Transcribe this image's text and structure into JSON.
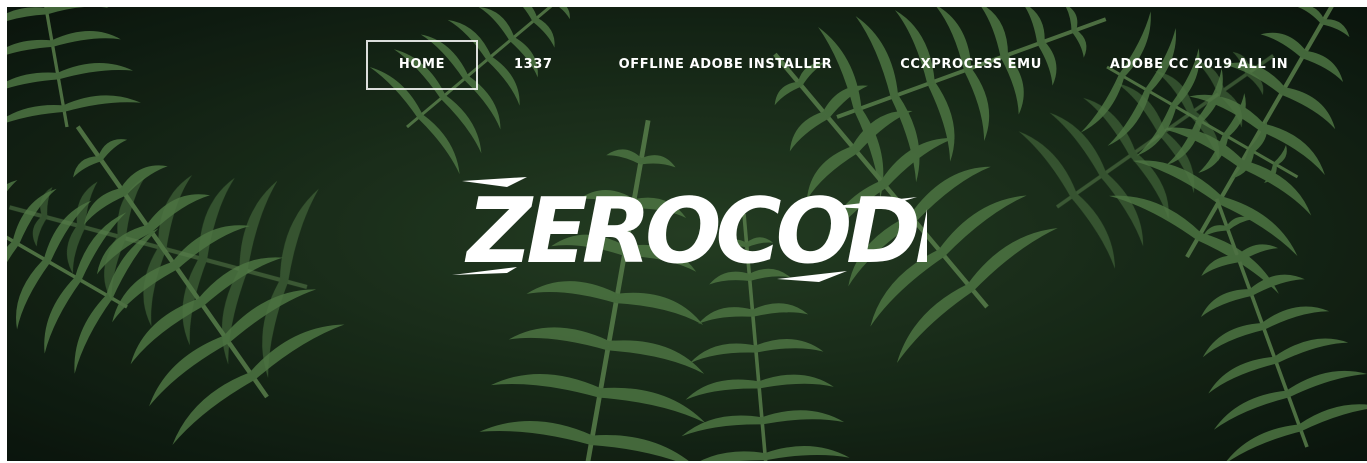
{
  "nav": {
    "items": [
      {
        "label": "HOME",
        "active": true
      },
      {
        "label": "1337",
        "active": false
      },
      {
        "label": "OFFLINE ADOBE INSTALLER",
        "active": false
      },
      {
        "label": "CCXPROCESS EMU",
        "active": false
      },
      {
        "label": "ADOBE CC 2019 ALL IN",
        "active": false
      }
    ]
  },
  "hero": {
    "logo_text": "ZEROCODE",
    "background": "fern-leaves-photo"
  },
  "colors": {
    "foliage_dark": "#0f1f14",
    "foliage_mid": "#3f6b3b",
    "foliage_light": "#7aa36b",
    "text": "#ffffff"
  }
}
